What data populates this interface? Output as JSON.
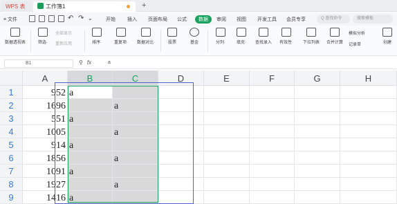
{
  "titlebar": {
    "wps_tab": "WPS 表格",
    "doc_tab": "工作簿1",
    "new_tab": "+"
  },
  "menubar": {
    "file_menu": "≡ 文件",
    "tabs": [
      "开始",
      "插入",
      "页面布局",
      "公式",
      "数据",
      "审阅",
      "视图",
      "开发工具",
      "会员专享"
    ],
    "active_tab": "数据",
    "search_command": "Q 查找命令",
    "search_template": "搜索模板"
  },
  "ribbon": {
    "buttons": [
      {
        "label": "数据透视表",
        "icon": "pivot-table-icon"
      },
      {
        "label": "筛选·",
        "icon": "filter-icon"
      },
      {
        "label": "排序·",
        "icon": "sort-icon"
      },
      {
        "label": "重复项·",
        "icon": "duplicates-icon"
      },
      {
        "label": "数据对比·",
        "icon": "data-compare-icon"
      },
      {
        "label": "股票",
        "icon": "stock-icon"
      },
      {
        "label": "基金",
        "icon": "fund-icon"
      },
      {
        "label": "分列·",
        "icon": "text-to-columns-icon"
      },
      {
        "label": "填充·",
        "icon": "fill-icon"
      },
      {
        "label": "查找录入",
        "icon": "lookup-entry-icon"
      },
      {
        "label": "有效性·",
        "icon": "validation-icon"
      },
      {
        "label": "下拉列表",
        "icon": "dropdown-list-icon"
      },
      {
        "label": "合并计算",
        "icon": "consolidate-icon"
      },
      {
        "label": "记录单",
        "icon": "record-form-icon"
      },
      {
        "label": "创建",
        "icon": "create-group-icon"
      }
    ],
    "filter_small": [
      "全部显示",
      "重新应用"
    ],
    "sim_analysis": "模拟分析"
  },
  "formulabar": {
    "cell_ref": "B1",
    "fx": "fx",
    "value": "a"
  },
  "sheet": {
    "columns": [
      "A",
      "B",
      "C",
      "D",
      "E",
      "F",
      "G",
      "H"
    ],
    "rows": [
      {
        "n": "1",
        "a": "952",
        "b": "a",
        "c": ""
      },
      {
        "n": "2",
        "a": "1696",
        "b": "",
        "c": "a"
      },
      {
        "n": "3",
        "a": "551",
        "b": "a",
        "c": ""
      },
      {
        "n": "4",
        "a": "1005",
        "b": "",
        "c": "a"
      },
      {
        "n": "5",
        "a": "914",
        "b": "a",
        "c": ""
      },
      {
        "n": "6",
        "a": "1856",
        "b": "",
        "c": "a"
      },
      {
        "n": "7",
        "a": "1091",
        "b": "a",
        "c": ""
      },
      {
        "n": "8",
        "a": "1927",
        "b": "",
        "c": "a"
      },
      {
        "n": "9",
        "a": "1416",
        "b": "a",
        "c": ""
      }
    ]
  },
  "colors": {
    "accent": "#1aa260",
    "selection_fill": "#d9d9d9",
    "annotation_box": "#4a64c8"
  }
}
